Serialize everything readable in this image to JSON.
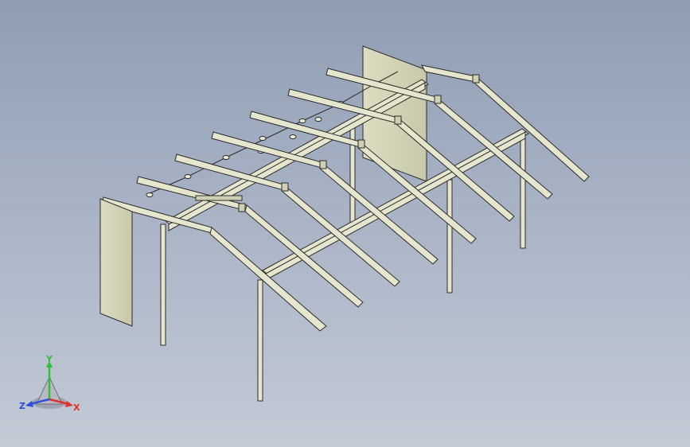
{
  "viewport": {
    "background_top": "#8f9db3",
    "background_bottom": "#c3cad6"
  },
  "model": {
    "member_fill": "#e6e6cf",
    "member_edge": "#2b2b2b",
    "panel_fill": "#d6d6bb",
    "panel_shade": "#c9c9ad"
  },
  "triad": {
    "x_label": "X",
    "y_label": "Y",
    "z_label": "Z",
    "x_color": "#e03030",
    "y_color": "#2fbf3a",
    "z_color": "#2f4fd8"
  }
}
